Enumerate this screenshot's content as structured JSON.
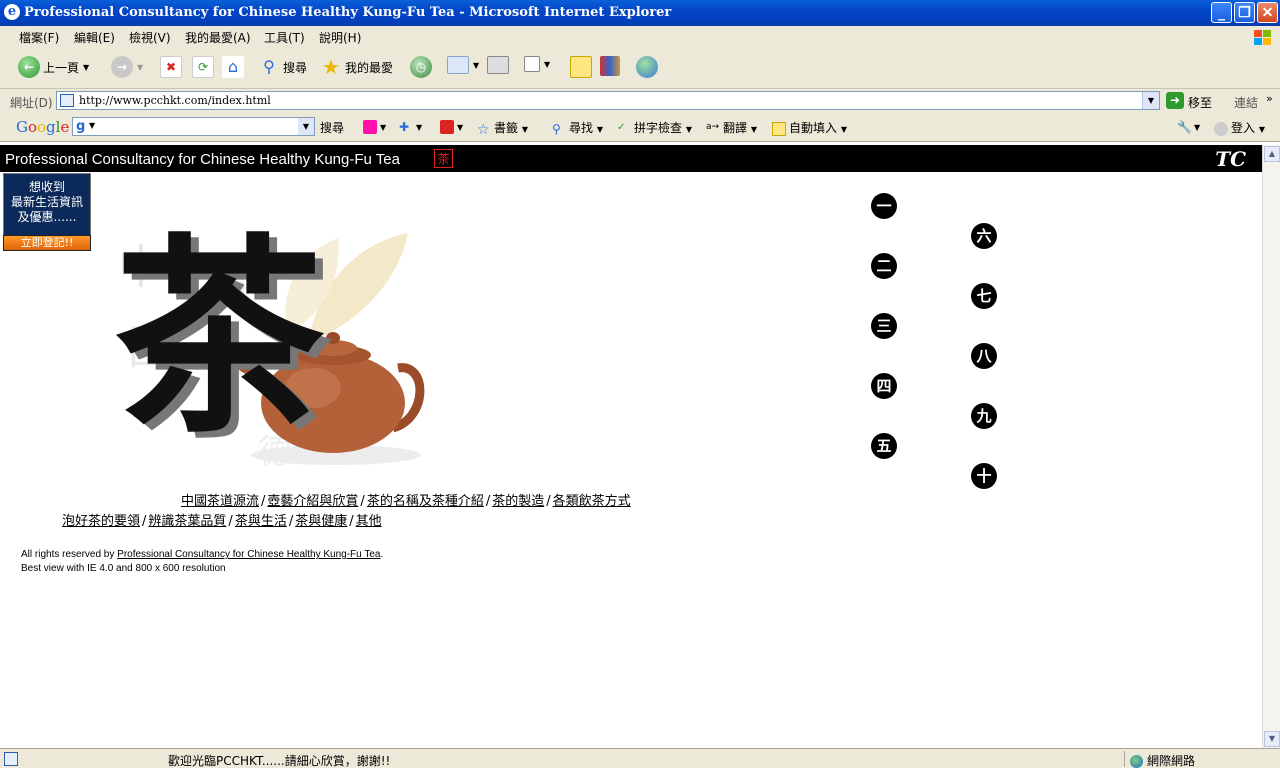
{
  "window": {
    "title": "Professional Consultancy for Chinese Healthy Kung-Fu Tea - Microsoft Internet Explorer",
    "minimize": "_",
    "maximize": "❐",
    "close": "✕"
  },
  "menubar": [
    "檔案(F)",
    "編輯(E)",
    "檢視(V)",
    "我的最愛(A)",
    "工具(T)",
    "說明(H)"
  ],
  "toolbar": {
    "back": "上一頁",
    "search": "搜尋",
    "favorites": "我的最愛"
  },
  "address": {
    "label": "網址(D)",
    "url": "http://www.pcchkt.com/index.html",
    "go": "移至",
    "links": "連結"
  },
  "google": {
    "logo": "Google",
    "search_label": "搜尋",
    "bookmarks": "書籤",
    "find": "尋找",
    "spellcheck": "拼字檢查",
    "translate": "翻譯",
    "autofill": "自動填入",
    "signin": "登入"
  },
  "site": {
    "header_title": "Professional Consultancy for  Chinese Healthy Kung-Fu Tea",
    "seal": "茶",
    "logo": "TC",
    "promo_line1": "想收到",
    "promo_line2": "最新生活資訊",
    "promo_line3": "及優惠......",
    "promo_button": "立即登記!!",
    "tea_char": "茶",
    "numbers_col1": [
      "一",
      "二",
      "三",
      "四",
      "五"
    ],
    "numbers_col2": [
      "六",
      "七",
      "八",
      "九",
      "十"
    ],
    "links_row1": [
      "中國茶道源流",
      "壺藝介紹與欣賞",
      "茶的名稱及茶種介紹",
      "茶的製造",
      "各類飲茶方式"
    ],
    "links_row2": [
      "泡好茶的要領",
      "辨識茶葉品質",
      "茶與生活",
      "茶與健康",
      "其他"
    ],
    "footer_prefix": "All rights reserved by ",
    "footer_link": "Professional Consultancy for Chinese Healthy Kung-Fu Tea",
    "footer_suffix": ".",
    "footer_line2": "Best view with IE 4.0 and 800 x 600 resolution"
  },
  "status": {
    "message": "歡迎光臨PCCHKT......請細心欣賞，謝謝!!",
    "zone": "網際網路"
  },
  "colors": {
    "titlebar": "#0346c8",
    "chrome": "#ece9d8",
    "header": "#000000",
    "promo": "#0b2a5a",
    "promo_button": "#e0620a"
  }
}
